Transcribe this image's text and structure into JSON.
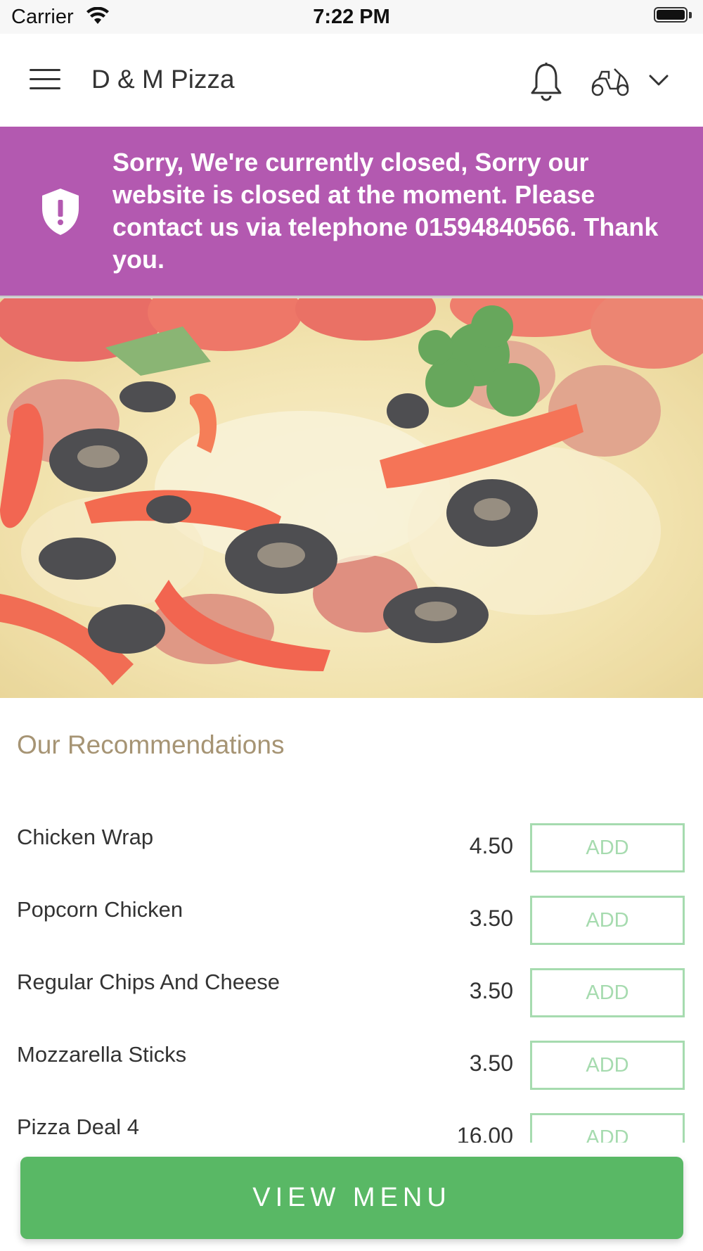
{
  "status_bar": {
    "carrier": "Carrier",
    "time": "7:22 PM"
  },
  "header": {
    "title": "D & M Pizza",
    "icons": [
      "menu-icon",
      "bell-icon",
      "scooter-icon",
      "chevron-down-icon"
    ]
  },
  "banner": {
    "message": "Sorry, We're currently closed, Sorry our website is closed at the moment. Please contact us via telephone 01594840566. Thank you.",
    "color": "#b359b0",
    "icon": "shield-alert-icon"
  },
  "recommendations": {
    "title": "Our Recommendations",
    "items": [
      {
        "name": "Chicken Wrap",
        "price": "4.50",
        "button": "ADD"
      },
      {
        "name": "Popcorn Chicken",
        "price": "3.50",
        "button": "ADD"
      },
      {
        "name": "Regular Chips And Cheese",
        "price": "3.50",
        "button": "ADD"
      },
      {
        "name": "Mozzarella Sticks",
        "price": "3.50",
        "button": "ADD"
      },
      {
        "name": "Pizza Deal 4",
        "price": "16.00",
        "button": "ADD"
      }
    ]
  },
  "footer": {
    "view_menu_label": "VIEW MENU",
    "color": "#59b865"
  }
}
